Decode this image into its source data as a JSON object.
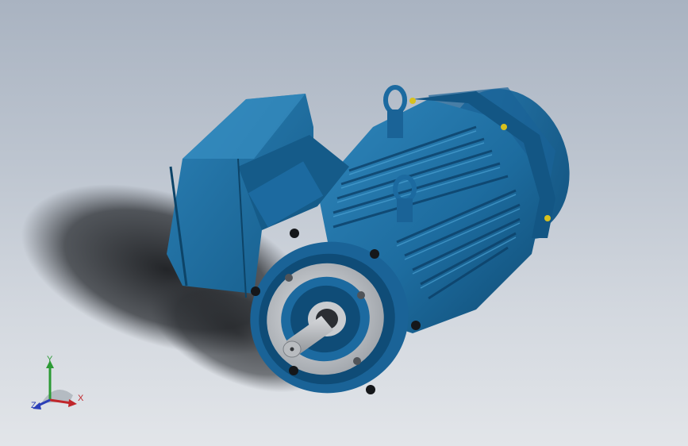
{
  "viewport": {
    "background_top": "#a9b3c1",
    "background_bottom": "#e2e5e9",
    "model": {
      "name": "motor-model",
      "body_color": "#1e6fa3",
      "body_dark": "#0d4468",
      "body_light": "#3f96c7",
      "flange_color": "#c9ccd0",
      "shaft_color": "#b9bcc0",
      "bolt_color": "#1a1a1a",
      "screw_color": "#c8b21a"
    }
  },
  "triad": {
    "x_label": "X",
    "y_label": "Y",
    "z_label": "Z",
    "x_color": "#c0262b",
    "y_color": "#2c9a35",
    "z_color": "#2b3fb8"
  }
}
